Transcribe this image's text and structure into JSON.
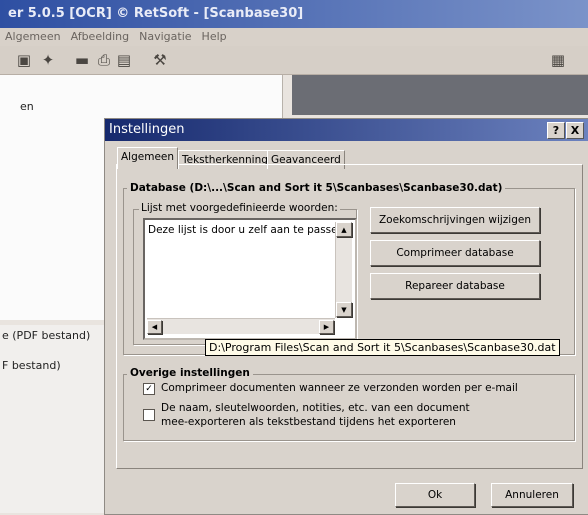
{
  "app": {
    "title": "er 5.0.5 [OCR] © RetSoft - [Scanbase30]",
    "menu": [
      "Algemeen",
      "Afbeelding",
      "Navigatie",
      "Help"
    ],
    "left_panel_text": "en",
    "lower_items": [
      "e (PDF bestand)",
      "F bestand)"
    ]
  },
  "dialog": {
    "title": "Instellingen",
    "help_btn": "?",
    "close_btn": "X",
    "tabs": [
      {
        "label": "Algemeen",
        "active": true
      },
      {
        "label": "Tekstherkenning",
        "active": false
      },
      {
        "label": "Geavanceerd",
        "active": false
      }
    ],
    "database": {
      "label": "Database (D:\\...\\Scan and Sort it 5\\Scanbases\\Scanbase30.dat)",
      "list_label": "Lijst met voorgedefinieerde woorden:",
      "list_text": "Deze lijst is door u zelf aan te passen",
      "buttons": [
        "Zoekomschrijvingen wijzigen",
        "Comprimeer database",
        "Repareer database"
      ],
      "tooltip": "D:\\Program Files\\Scan and Sort it 5\\Scanbases\\Scanbase30.dat"
    },
    "other": {
      "label": "Overige instellingen",
      "checkbox1": {
        "label": "Comprimeer documenten wanneer ze verzonden worden per e-mail",
        "checked": true
      },
      "checkbox2": {
        "line1": "De naam, sleutelwoorden, notities, etc. van een document",
        "line2": "mee-exporteren als tekstbestand tijdens het exporteren",
        "checked": false
      }
    },
    "ok": "Ok",
    "cancel": "Annuleren"
  }
}
